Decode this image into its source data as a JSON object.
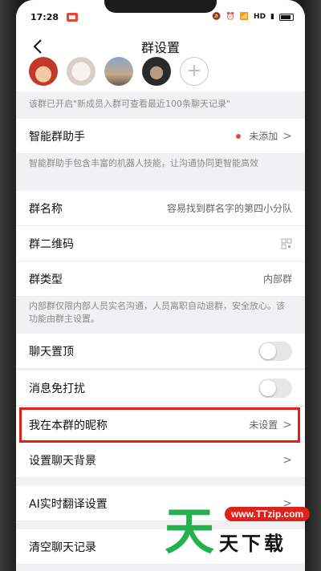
{
  "status": {
    "time": "17:28",
    "network": "HD"
  },
  "nav": {
    "title": "群设置"
  },
  "history_note": "该群已开启\"新成员入群可查看最近100条聊天记录\"",
  "assistant": {
    "label": "智能群助手",
    "value": "未添加"
  },
  "assistant_note": "智能群助手包含丰富的机器人技能，让沟通协同更智能高效",
  "group_name": {
    "label": "群名称",
    "value": "容易找到群名字的第四小分队"
  },
  "qr": {
    "label": "群二维码"
  },
  "group_type": {
    "label": "群类型",
    "value": "内部群"
  },
  "type_note": "内部群仅限内部人员实名沟通，人员离职自动退群，安全放心。该功能由群主设置。",
  "pin": {
    "label": "聊天置顶",
    "on": false
  },
  "mute": {
    "label": "消息免打扰",
    "on": false
  },
  "nickname": {
    "label": "我在本群的昵称",
    "value": "未设置"
  },
  "background": {
    "label": "设置聊天背景"
  },
  "translate": {
    "label": "AI实时翻译设置"
  },
  "clear": {
    "label": "清空聊天记录"
  },
  "watermark": {
    "char": "天",
    "url": "www.TTzip.com",
    "text": "天下载"
  },
  "colors": {
    "accent_red": "#e0201a",
    "watermark_green": "#22b14c"
  }
}
